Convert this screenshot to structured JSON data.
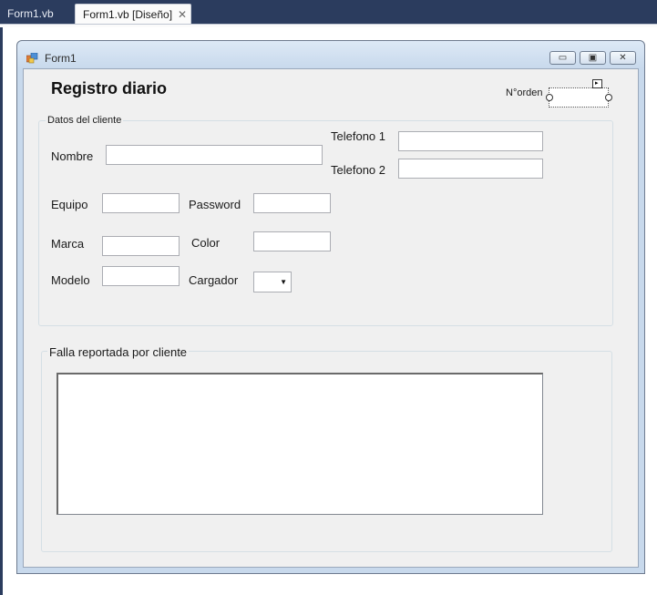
{
  "ide": {
    "tabs": [
      {
        "label": "Form1.vb",
        "active": false
      },
      {
        "label": "Form1.vb [Diseño]",
        "active": true
      }
    ],
    "close_glyph": "✕"
  },
  "form": {
    "title": "Form1",
    "heading": "Registro diario",
    "caption_buttons": {
      "minimize": "▭",
      "maximize": "▣",
      "close": "✕"
    },
    "norden_label": "N°orden",
    "client_group": {
      "title": "Datos del cliente",
      "fields": {
        "nombre": "Nombre",
        "telefono1": "Telefono 1",
        "telefono2": "Telefono 2",
        "equipo": "Equipo",
        "password": "Password",
        "marca": "Marca",
        "color": "Color",
        "modelo": "Modelo",
        "cargador": "Cargador"
      }
    },
    "falla_group": {
      "title": "Falla reportada por cliente"
    }
  },
  "icons": {
    "form_icon": "form-icon",
    "dropdown": "▼",
    "smart_tag": "▸"
  },
  "colors": {
    "ide_bar": "#2b3c5e",
    "form_frame": "#c8d9ec",
    "client_bg": "#f0f0f0"
  }
}
